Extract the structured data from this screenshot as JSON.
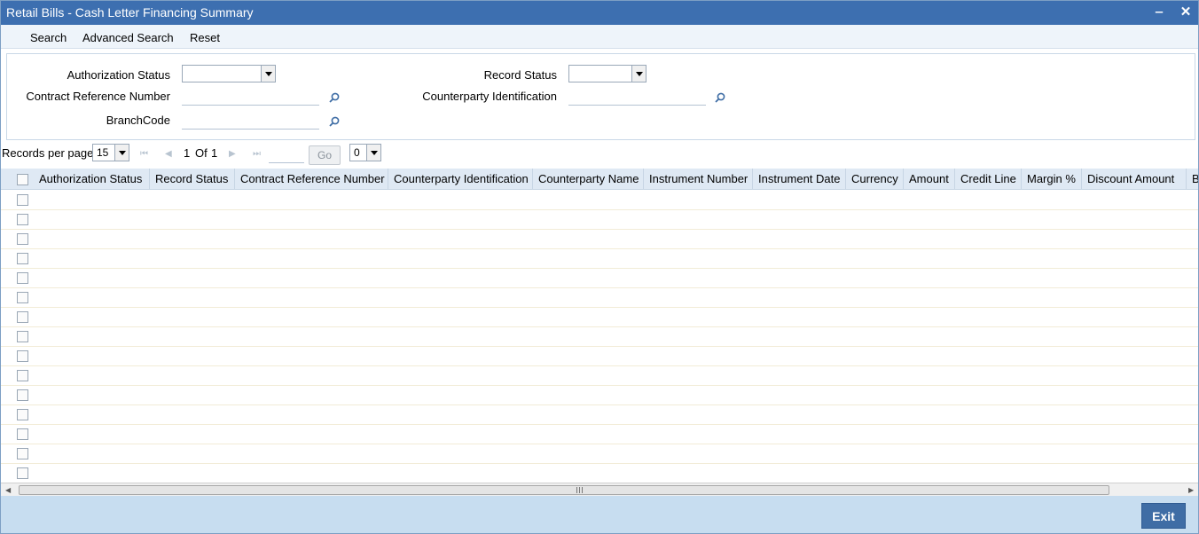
{
  "window": {
    "title": "Retail Bills - Cash Letter Financing Summary",
    "minimize_icon": "minimize-icon",
    "close_icon": "close-icon"
  },
  "menu": {
    "search": "Search",
    "advanced_search": "Advanced Search",
    "reset": "Reset"
  },
  "criteria": {
    "authorization_status_label": "Authorization Status",
    "authorization_status_value": "",
    "record_status_label": "Record Status",
    "record_status_value": "",
    "contract_reference_label": "Contract Reference Number",
    "contract_reference_value": "",
    "counterparty_identification_label": "Counterparty Identification",
    "counterparty_identification_value": "",
    "branch_code_label": "BranchCode",
    "branch_code_value": ""
  },
  "pager": {
    "records_per_page_label": "Records per page",
    "records_per_page_value": "15",
    "page_current": "1",
    "page_of": "Of",
    "page_total": "1",
    "go_label": "Go",
    "goto_value": "",
    "extra_select_value": "0"
  },
  "grid": {
    "columns": [
      "Authorization Status",
      "Record Status",
      "Contract Reference Number",
      "Counterparty Identification",
      "Counterparty Name",
      "Instrument Number",
      "Instrument Date",
      "Currency",
      "Amount",
      "Credit Line",
      "Margin %",
      "Discount Amount",
      "Br"
    ],
    "row_count": 15
  },
  "footer": {
    "exit_label": "Exit"
  },
  "colors": {
    "titlebar": "#3d6fb0",
    "footer": "#c7ddf0",
    "header_row": "#dfe9f4",
    "exit_button": "#3f6da5"
  }
}
